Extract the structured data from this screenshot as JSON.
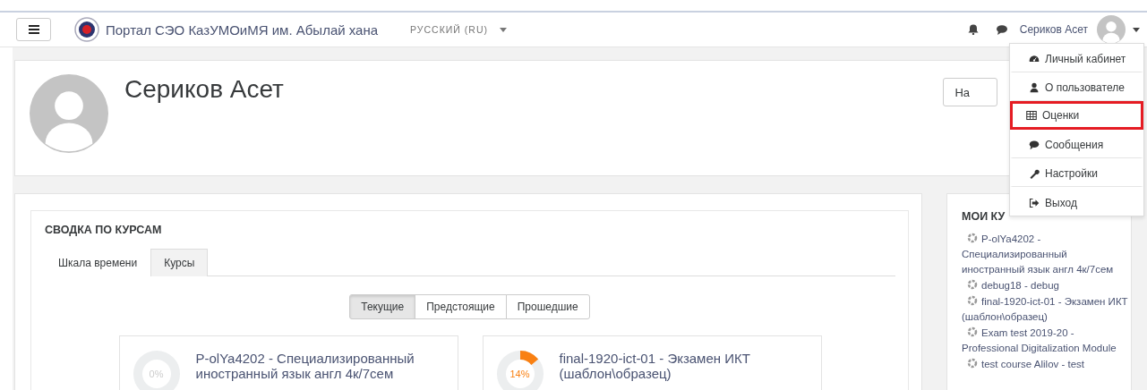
{
  "navbar": {
    "site_name": "Портал СЭО КазУМОиМЯ им. Абылай хана",
    "language": "РУССКИЙ (RU)",
    "user_name": "Сериков Асет"
  },
  "user_menu": [
    {
      "kind": "dashboard",
      "label": "Личный кабинет",
      "highlighted": false
    },
    {
      "kind": "user",
      "label": "О пользователе",
      "highlighted": false
    },
    {
      "kind": "table",
      "label": "Оценки",
      "highlighted": true
    },
    {
      "kind": "chat",
      "label": "Сообщения",
      "highlighted": false
    },
    {
      "kind": "wrench",
      "label": "Настройки",
      "highlighted": false
    },
    {
      "kind": "exit",
      "label": "Выход",
      "highlighted": false
    }
  ],
  "header": {
    "name": "Сериков Асет",
    "button": "На"
  },
  "course_overview": {
    "title": "СВОДКА ПО КУРСАМ",
    "tabs": [
      {
        "label": "Шкала времени",
        "selected": false
      },
      {
        "label": "Курсы",
        "selected": true
      }
    ],
    "filters": [
      {
        "label": "Текущие",
        "selected": true
      },
      {
        "label": "Предстоящие",
        "selected": false
      },
      {
        "label": "Прошедшие",
        "selected": false
      }
    ],
    "courses": [
      {
        "title": "P-olYa4202 - Специализированный иностранный язык англ 4к/7сем",
        "level": 0,
        "reading": "0%"
      },
      {
        "title": "final-1920-ict-01 - Экзамен ИКТ (шаблон\\образец)",
        "level": 0.14,
        "reading": "14%"
      }
    ]
  },
  "sidebar": {
    "title": "МОИ КУ",
    "courses": [
      "P-olYa4202 - Специализированный иностранный язык англ 4к/7сем",
      "debug18 - debug",
      "final-1920-ict-01 - Экзамен ИКТ (шаблон\\образец)",
      "Exam test 2019-20 - Professional Digitalization Module",
      "test course Alilov - test"
    ]
  }
}
